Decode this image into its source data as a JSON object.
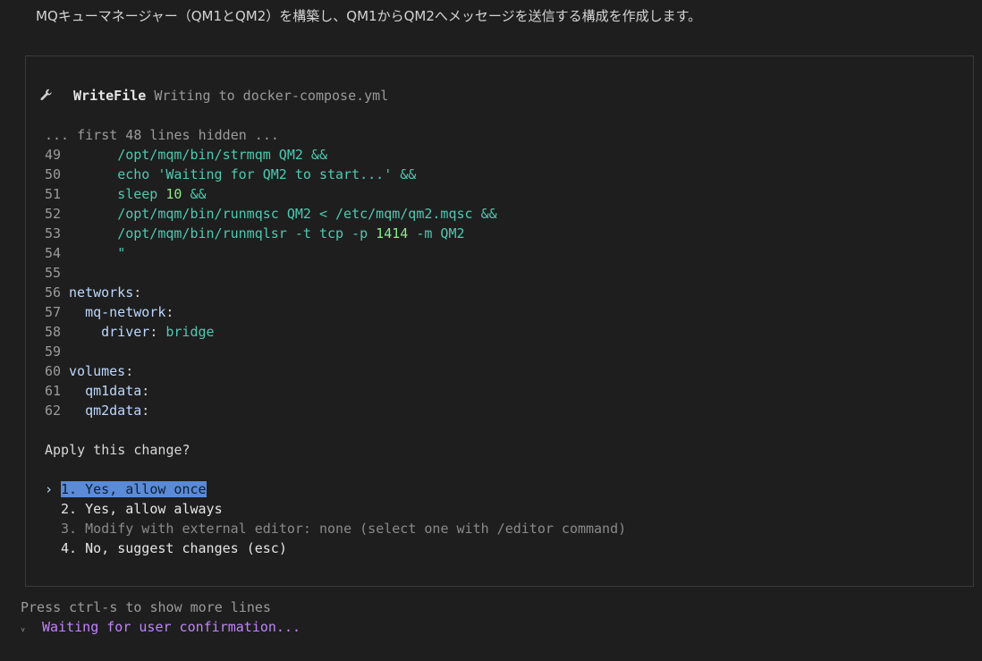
{
  "top_message": "MQキューマネージャー（QM1とQM2）を構築し、QM1からQM2へメッセージを送信する構成を作成します。",
  "tool": {
    "icon": "wrench-icon",
    "name": "WriteFile",
    "description": "Writing to docker-compose.yml"
  },
  "code": {
    "hidden_note": "... first 48 lines hidden ...",
    "lines": [
      {
        "n": "49",
        "indent": "      ",
        "parts": [
          {
            "c": "cyan",
            "t": "/opt/mqm/bin/strmqm QM2 &&"
          }
        ]
      },
      {
        "n": "50",
        "indent": "      ",
        "parts": [
          {
            "c": "cyan",
            "t": "echo 'Waiting for QM2 to start...' &&"
          }
        ]
      },
      {
        "n": "51",
        "indent": "      ",
        "parts": [
          {
            "c": "cyan",
            "t": "sleep "
          },
          {
            "c": "num",
            "t": "10"
          },
          {
            "c": "cyan",
            "t": " &&"
          }
        ]
      },
      {
        "n": "52",
        "indent": "      ",
        "parts": [
          {
            "c": "cyan",
            "t": "/opt/mqm/bin/runmqsc QM2 < /etc/mqm/qm2.mqsc &&"
          }
        ]
      },
      {
        "n": "53",
        "indent": "      ",
        "parts": [
          {
            "c": "cyan",
            "t": "/opt/mqm/bin/runmqlsr -t tcp -p "
          },
          {
            "c": "num",
            "t": "1414"
          },
          {
            "c": "cyan",
            "t": " -m QM2"
          }
        ]
      },
      {
        "n": "54",
        "indent": "      ",
        "parts": [
          {
            "c": "cyan",
            "t": "\""
          }
        ]
      },
      {
        "n": "55",
        "indent": "",
        "parts": []
      },
      {
        "n": "56",
        "indent": "",
        "parts": [
          {
            "c": "key",
            "t": "networks"
          },
          {
            "c": "txt",
            "t": ":"
          }
        ]
      },
      {
        "n": "57",
        "indent": "  ",
        "parts": [
          {
            "c": "key",
            "t": "mq-network"
          },
          {
            "c": "txt",
            "t": ":"
          }
        ]
      },
      {
        "n": "58",
        "indent": "    ",
        "parts": [
          {
            "c": "key",
            "t": "driver"
          },
          {
            "c": "txt",
            "t": ": "
          },
          {
            "c": "cyan",
            "t": "bridge"
          }
        ]
      },
      {
        "n": "59",
        "indent": "",
        "parts": []
      },
      {
        "n": "60",
        "indent": "",
        "parts": [
          {
            "c": "key",
            "t": "volumes"
          },
          {
            "c": "txt",
            "t": ":"
          }
        ]
      },
      {
        "n": "61",
        "indent": "  ",
        "parts": [
          {
            "c": "key",
            "t": "qm1data"
          },
          {
            "c": "txt",
            "t": ":"
          }
        ]
      },
      {
        "n": "62",
        "indent": "  ",
        "parts": [
          {
            "c": "key",
            "t": "qm2data"
          },
          {
            "c": "txt",
            "t": ":"
          }
        ]
      }
    ]
  },
  "prompt": "Apply this change?",
  "options": [
    {
      "label": "1. Yes, allow once",
      "selected": true,
      "dim": false
    },
    {
      "label": "2. Yes, allow always",
      "selected": false,
      "dim": false
    },
    {
      "label": "3. Modify with external editor: none (select one with /editor command)",
      "selected": false,
      "dim": true
    },
    {
      "label": "4. No, suggest changes (esc)",
      "selected": false,
      "dim": false
    }
  ],
  "selector_glyph": "›",
  "footer_hint": "Press ctrl-s to show more lines",
  "status": {
    "spinner": "ᵥ",
    "text": "Waiting for user confirmation..."
  }
}
